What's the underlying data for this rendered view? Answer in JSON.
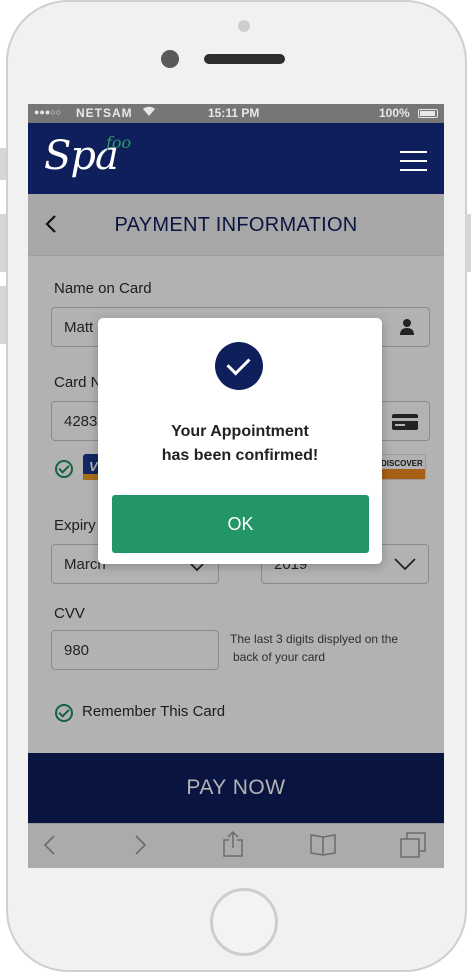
{
  "status_bar": {
    "signal": "●●●○○",
    "carrier": "NETSAM",
    "time": "15:11 PM",
    "battery": "100%"
  },
  "app": {
    "logo_main": "Spa",
    "logo_sub": "foo"
  },
  "page": {
    "title": "PAYMENT INFORMATION"
  },
  "form": {
    "name_label": "Name on Card",
    "name_value": "Matt",
    "card_label": "Card N",
    "card_value": "4283",
    "card_logos": [
      "VISA",
      "DISCOVER"
    ],
    "expiry_label": "Expiry",
    "expiry_month": "March",
    "expiry_year": "2019",
    "cvv_label": "CVV",
    "cvv_value": "980",
    "cvv_hint_line1": "The last 3 digits displyed on the",
    "cvv_hint_line2": "back of  your card",
    "remember_label": "Remember This Card"
  },
  "pay_button": "PAY NOW",
  "modal": {
    "line1": "Your Appointment",
    "line2": "has been confirmed!",
    "ok_label": "OK"
  },
  "colors": {
    "brand_navy": "#0e1f5c",
    "confirm_green": "#239566",
    "accent_green": "#2a9d5c"
  }
}
